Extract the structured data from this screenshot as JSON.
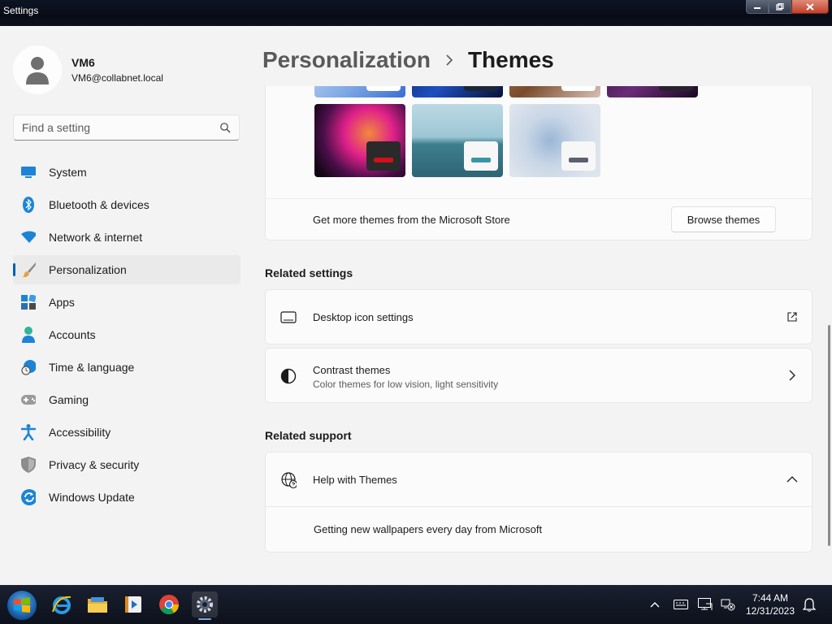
{
  "window": {
    "title": "Settings",
    "controls": [
      "minimize-button",
      "restore-button",
      "close-button"
    ]
  },
  "profile": {
    "name": "VM6",
    "email": "VM6@collabnet.local"
  },
  "search": {
    "placeholder": "Find a setting"
  },
  "nav": [
    {
      "label": "System",
      "icon": "monitor-icon"
    },
    {
      "label": "Bluetooth & devices",
      "icon": "bluetooth-icon"
    },
    {
      "label": "Network & internet",
      "icon": "wifi-icon"
    },
    {
      "label": "Personalization",
      "icon": "brush-icon",
      "active": true
    },
    {
      "label": "Apps",
      "icon": "apps-icon"
    },
    {
      "label": "Accounts",
      "icon": "person-icon"
    },
    {
      "label": "Time & language",
      "icon": "clock-globe-icon"
    },
    {
      "label": "Gaming",
      "icon": "gamepad-icon"
    },
    {
      "label": "Accessibility",
      "icon": "accessibility-icon"
    },
    {
      "label": "Privacy & security",
      "icon": "shield-icon"
    },
    {
      "label": "Windows Update",
      "icon": "update-icon"
    }
  ],
  "header": {
    "parent": "Personalization",
    "separator": "chevron-right-icon",
    "current": "Themes"
  },
  "themes": {
    "more_text": "Get more themes from the Microsoft Store",
    "browse_label": "Browse themes",
    "visible_thumbnails": [
      "bloom-dark-theme",
      "bloom-light-theme",
      "sunrise-theme",
      "flow-theme",
      "glow-dark-theme",
      "glow-theme",
      "lake-theme",
      "flow-light-theme"
    ]
  },
  "related_settings": {
    "heading": "Related settings",
    "items": [
      {
        "title": "Desktop icon settings",
        "subtitle": "",
        "icon": "desktop-icon",
        "action": "external-link-icon"
      },
      {
        "title": "Contrast themes",
        "subtitle": "Color themes for low vision, light sensitivity",
        "icon": "contrast-icon",
        "action": "chevron-right-icon"
      }
    ]
  },
  "related_support": {
    "heading": "Related support",
    "item": {
      "title": "Help with Themes",
      "icon": "globe-help-icon",
      "action": "chevron-up-icon"
    },
    "expanded_text": "Getting new wallpapers every day from Microsoft"
  },
  "taskbar": {
    "apps": [
      "internet-explorer-icon",
      "file-explorer-icon",
      "media-player-icon",
      "chrome-icon",
      "settings-icon"
    ],
    "tray": [
      "show-hidden-icons-chevron",
      "keyboard-icon",
      "action-center-icon",
      "network-disconnected-icon",
      "notification-bell-icon"
    ],
    "time": "7:44 AM",
    "date": "12/31/2023"
  },
  "colors": {
    "accent": "#005fb8",
    "window_bg": "#f3f3f3",
    "card_bg": "#fbfbfb",
    "taskbar_bg": "#0d111c"
  }
}
